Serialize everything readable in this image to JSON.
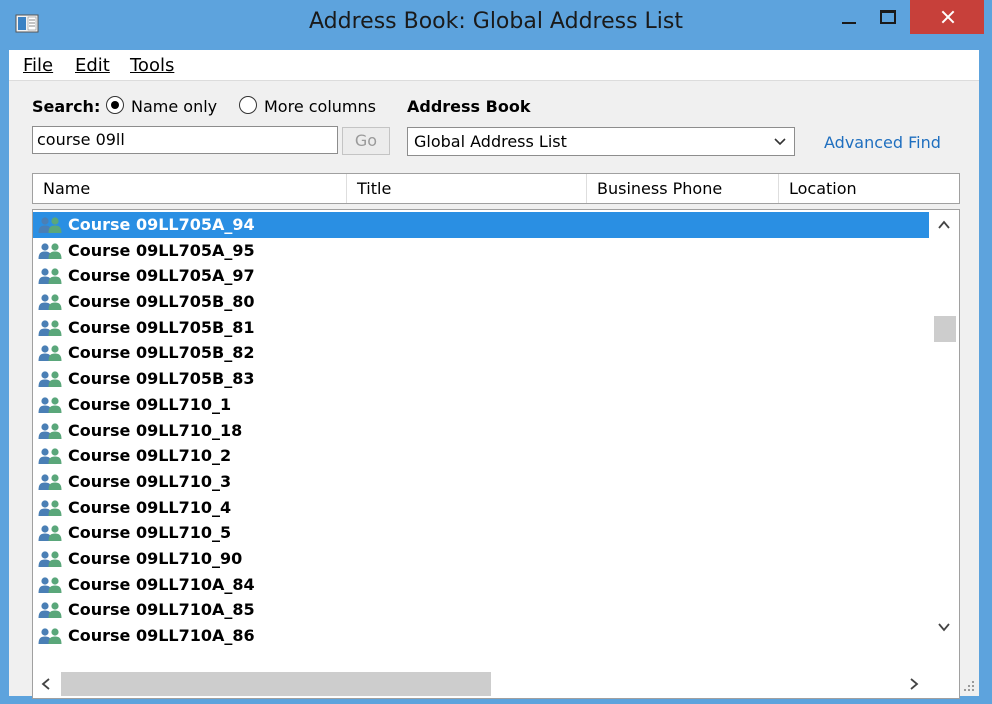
{
  "window": {
    "title": "Address Book: Global Address List",
    "accent_color": "#5da3dd",
    "close_color": "#c7403a"
  },
  "menu": {
    "items": [
      {
        "label": "File"
      },
      {
        "label": "Edit"
      },
      {
        "label": "Tools"
      }
    ]
  },
  "search": {
    "label": "Search:",
    "option_name_only": "Name only",
    "option_more_columns": "More columns",
    "selected_option": "Name only",
    "value": "course 09ll",
    "go_label": "Go"
  },
  "address_book": {
    "label": "Address Book",
    "selected": "Global Address List",
    "advanced_find": "Advanced Find"
  },
  "columns": [
    "Name",
    "Title",
    "Business Phone",
    "Location"
  ],
  "rows": [
    {
      "name": "Course 09LL705A_94",
      "selected": true
    },
    {
      "name": "Course 09LL705A_95"
    },
    {
      "name": "Course 09LL705A_97"
    },
    {
      "name": "Course 09LL705B_80"
    },
    {
      "name": "Course 09LL705B_81"
    },
    {
      "name": "Course 09LL705B_82"
    },
    {
      "name": "Course 09LL705B_83"
    },
    {
      "name": "Course 09LL710_1"
    },
    {
      "name": "Course 09LL710_18"
    },
    {
      "name": "Course 09LL710_2"
    },
    {
      "name": "Course 09LL710_3"
    },
    {
      "name": "Course 09LL710_4"
    },
    {
      "name": "Course 09LL710_5"
    },
    {
      "name": "Course 09LL710_90"
    },
    {
      "name": "Course 09LL710A_84"
    },
    {
      "name": "Course 09LL710A_85"
    },
    {
      "name": "Course 09LL710A_86"
    }
  ],
  "selection_color": "#2a8fe3",
  "link_color": "#1f6fbf"
}
